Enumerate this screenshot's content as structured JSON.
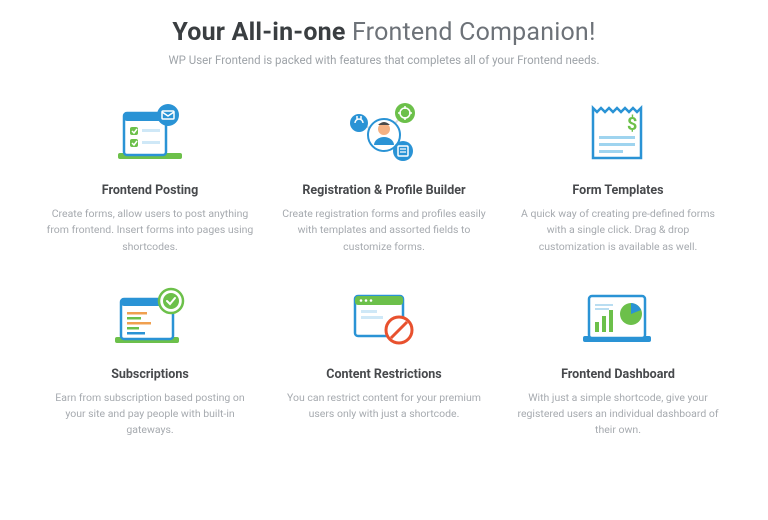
{
  "hero": {
    "title_bold": "Your All-in-one",
    "title_rest": " Frontend Companion!",
    "subtitle": "WP User Frontend is packed with features that completes all of your Frontend needs."
  },
  "features": [
    {
      "title": "Frontend Posting",
      "desc": "Create forms, allow users to post anything from frontend. Insert forms into pages using shortcodes."
    },
    {
      "title": "Registration & Profile Builder",
      "desc": "Create registration forms and profiles easily with templates and assorted fields to customize forms."
    },
    {
      "title": "Form Templates",
      "desc": "A quick way of creating pre-defined forms with a single click. Drag & drop customization is available as well."
    },
    {
      "title": "Subscriptions",
      "desc": "Earn from subscription based posting on your site and pay people with built-in gateways."
    },
    {
      "title": "Content Restrictions",
      "desc": "You can restrict content for your premium users only with just a shortcode."
    },
    {
      "title": "Frontend Dashboard",
      "desc": "With just a simple shortcode, give your registered users an individual dashboard of their own."
    }
  ]
}
